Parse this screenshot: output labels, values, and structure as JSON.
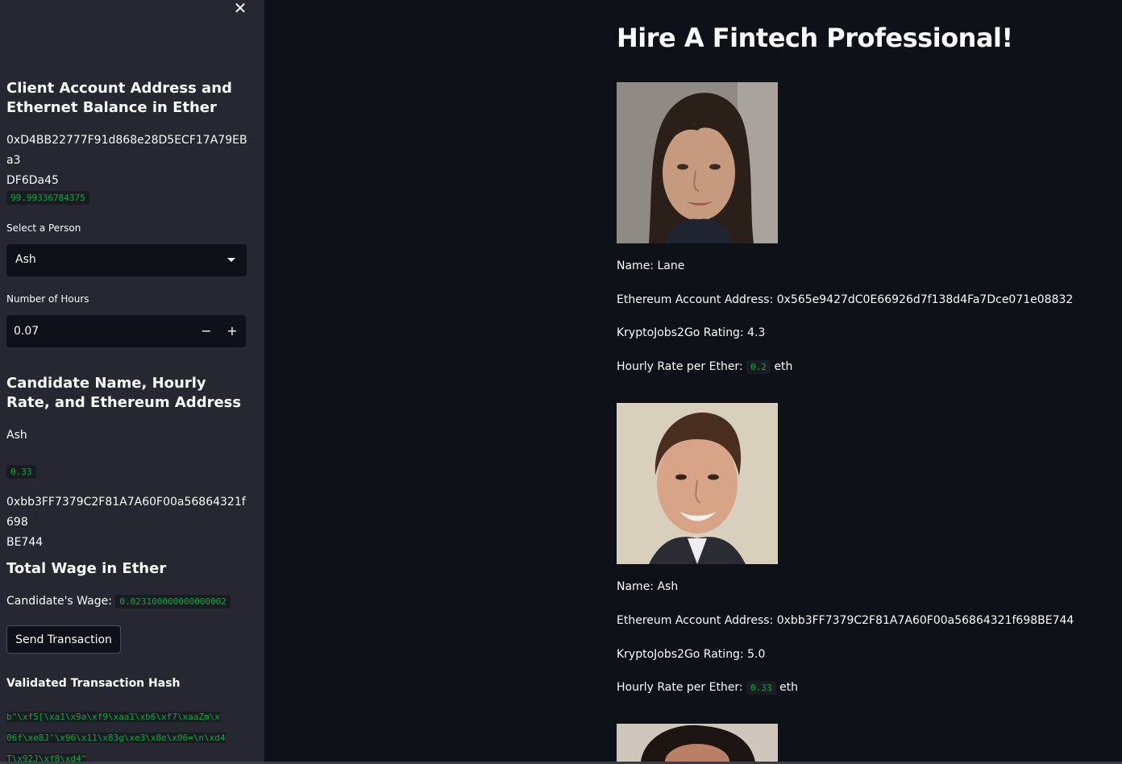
{
  "sidebar": {
    "close_icon": "close-icon",
    "client_heading": "Client Account Address and Ethernet Balance in Ether",
    "client_address_line1": "0xD4BB22777F91d868e28D5ECF17A79EBa3",
    "client_address_line2": "DF6Da45",
    "client_balance": "99.99336784375",
    "select_label": "Select a Person",
    "select_value": "Ash",
    "hours_label": "Number of Hours",
    "hours_value": "0.07",
    "minus_label": "−",
    "plus_label": "+",
    "candidate_heading": "Candidate Name, Hourly Rate, and Ethereum Address",
    "candidate_name": "Ash",
    "candidate_rate": "0.33",
    "candidate_address_line1": "0xbb3FF7379C2F81A7A60F00a56864321f698",
    "candidate_address_line2": "BE744",
    "wage_heading": "Total Wage in Ether",
    "wage_label": "Candidate's Wage:",
    "wage_value": "0.023100000000000002",
    "send_button": "Send Transaction",
    "hash_heading": "Validated Transaction Hash",
    "hash_line1": "b\"\\xf5[\\xa1\\x9a\\xf9\\xaa1\\xb6\\xf7\\xaaZm\\x",
    "hash_line2": "06f\\xe8J'\\x96\\x11\\x83g\\xe3\\x8e\\x06=\\n\\xd4",
    "hash_line3": "T\\x92J\\xf8\\xd4\""
  },
  "main": {
    "title": "Hire A Fintech Professional!",
    "candidates": [
      {
        "name": "Name: Lane",
        "address": "Ethereum Account Address: 0x565e9427dC0E66926d7f138d4Fa7Dce071e08832",
        "rating": "KryptoJobs2Go Rating: 4.3",
        "rate_label": "Hourly Rate per Ether:",
        "rate_value": "0.2",
        "rate_unit": "eth"
      },
      {
        "name": "Name: Ash",
        "address": "Ethereum Account Address: 0xbb3FF7379C2F81A7A60F00a56864321f698BE744",
        "rating": "KryptoJobs2Go Rating: 5.0",
        "rate_label": "Hourly Rate per Ether:",
        "rate_value": "0.33",
        "rate_unit": "eth"
      }
    ]
  },
  "colors": {
    "background": "#0e1117",
    "sidebar": "#262730",
    "code_green": "#09ab3b",
    "text": "#fafafa"
  }
}
